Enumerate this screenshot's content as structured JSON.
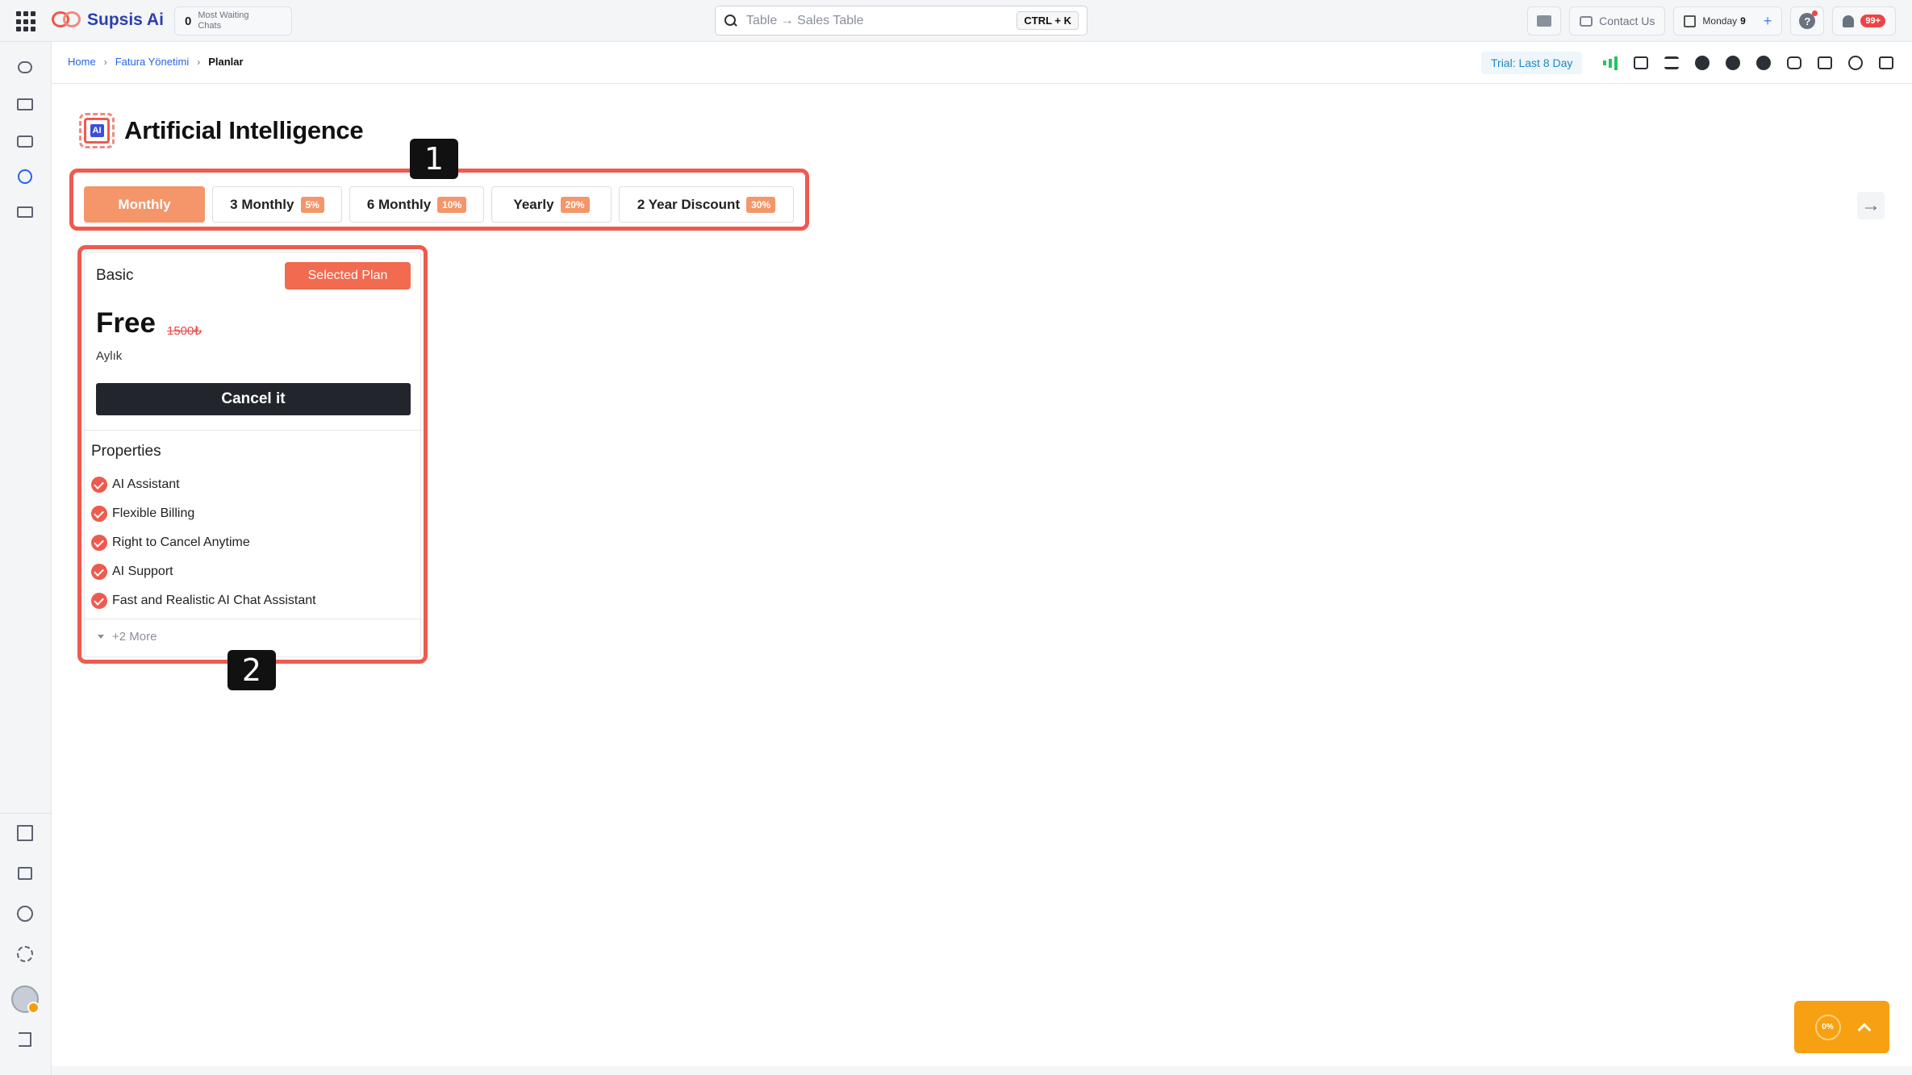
{
  "app": {
    "name": "Supsis Ai",
    "waiting_count": "0",
    "waiting_label": "Most Waiting Chats"
  },
  "search": {
    "value": "Table → Sales Table",
    "shortcut": "CTRL + K"
  },
  "topbar": {
    "contact_label": "Contact Us",
    "day_label": "Monday",
    "day_number": "9",
    "notifications_badge": "99+"
  },
  "breadcrumb": {
    "items": [
      "Home",
      "Fatura Yönetimi",
      "Planlar"
    ]
  },
  "trial": {
    "label": "Trial: Last 8 Day"
  },
  "page": {
    "title": "Artificial Intelligence",
    "chip_text": "AI"
  },
  "tabs": [
    {
      "label": "Monthly",
      "discount": "",
      "active": true
    },
    {
      "label": "3 Monthly",
      "discount": "5%",
      "active": false
    },
    {
      "label": "6 Monthly",
      "discount": "10%",
      "active": false
    },
    {
      "label": "Yearly",
      "discount": "20%",
      "active": false
    },
    {
      "label": "2 Year Discount",
      "discount": "30%",
      "active": false
    }
  ],
  "markers": {
    "one": "1",
    "two": "2"
  },
  "plan": {
    "name": "Basic",
    "status_label": "Selected Plan",
    "price": "Free",
    "old_price": "1500₺",
    "period": "Aylık",
    "action_label": "Cancel it",
    "properties_title": "Properties",
    "properties": [
      "AI Assistant",
      "Flexible Billing",
      "Right to Cancel Anytime",
      "AI Support",
      "Fast and Realistic AI Chat Assistant"
    ],
    "more_label": "+2 More"
  },
  "scroll_widget": {
    "progress_label": "0%"
  },
  "colors": {
    "accent": "#ef5a4f",
    "tab_active": "#f4966a",
    "brand_blue": "#2a3fb0",
    "scroll_widget": "#f7a012"
  }
}
